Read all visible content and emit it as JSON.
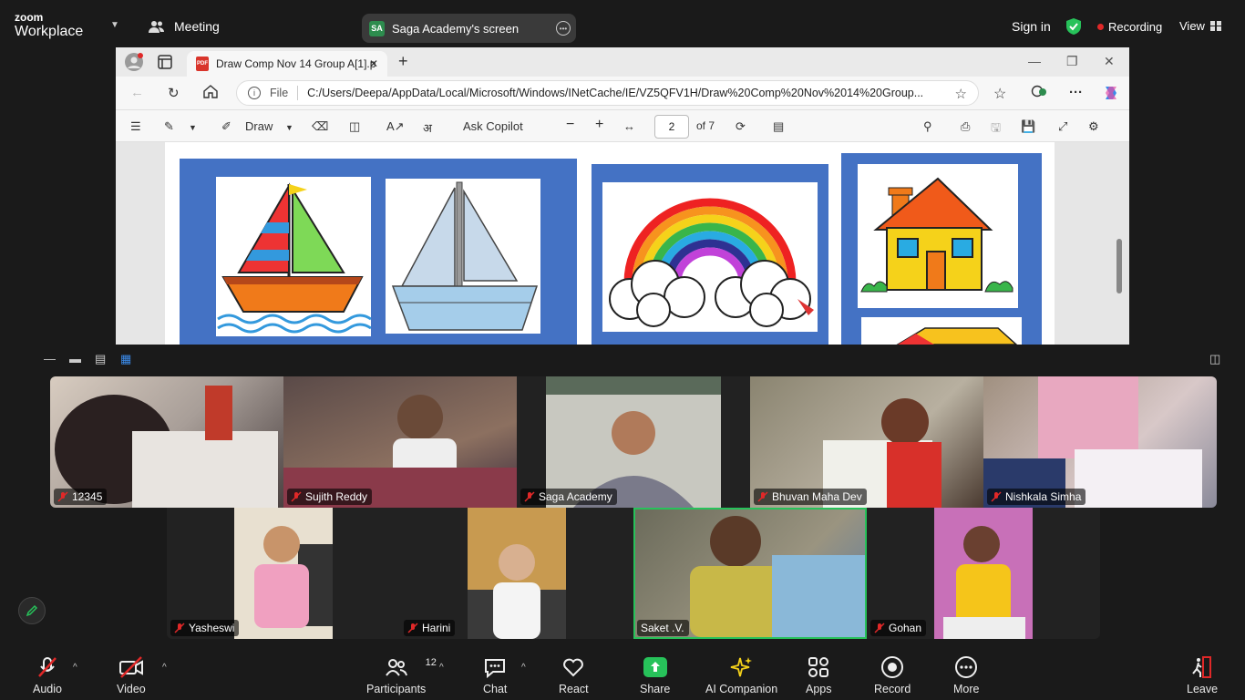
{
  "topbar": {
    "logo_line1": "zoom",
    "logo_line2": "Workplace",
    "meeting_label": "Meeting",
    "screen_badge": "SA",
    "screen_label": "Saga Academy's screen",
    "sign_in": "Sign in",
    "recording": "Recording",
    "view": "View"
  },
  "browser": {
    "tab_title": "Draw Comp Nov 14 Group A[1].p",
    "url_scheme": "File",
    "url": "C:/Users/Deepa/AppData/Local/Microsoft/Windows/INetCache/IE/VZ5QFV1H/Draw%20Comp%20Nov%2014%20Group...",
    "pdf_toolbar": {
      "draw": "Draw",
      "ask_copilot": "Ask Copilot",
      "page_value": "2",
      "page_total": "of 7"
    }
  },
  "gallery": {
    "row1": [
      {
        "name": "12345"
      },
      {
        "name": "Sujith Reddy"
      },
      {
        "name": "Saga Academy"
      },
      {
        "name": "Bhuvan Maha Dev"
      },
      {
        "name": "Nishkala Simha"
      }
    ],
    "row2": [
      {
        "name": "Yasheswi"
      },
      {
        "name": "Harini"
      },
      {
        "name": "Saket .V."
      },
      {
        "name": "Gohan"
      }
    ]
  },
  "bottombar": {
    "audio": "Audio",
    "video": "Video",
    "participants": "Participants",
    "participants_count": "12",
    "chat": "Chat",
    "react": "React",
    "share": "Share",
    "ai_companion": "AI Companion",
    "apps": "Apps",
    "record": "Record",
    "more": "More",
    "leave": "Leave"
  },
  "colors": {
    "accent_green": "#27c25a",
    "recording_red": "#e02828",
    "mute_red": "#e02828",
    "pdf_blue": "#4472c4"
  }
}
